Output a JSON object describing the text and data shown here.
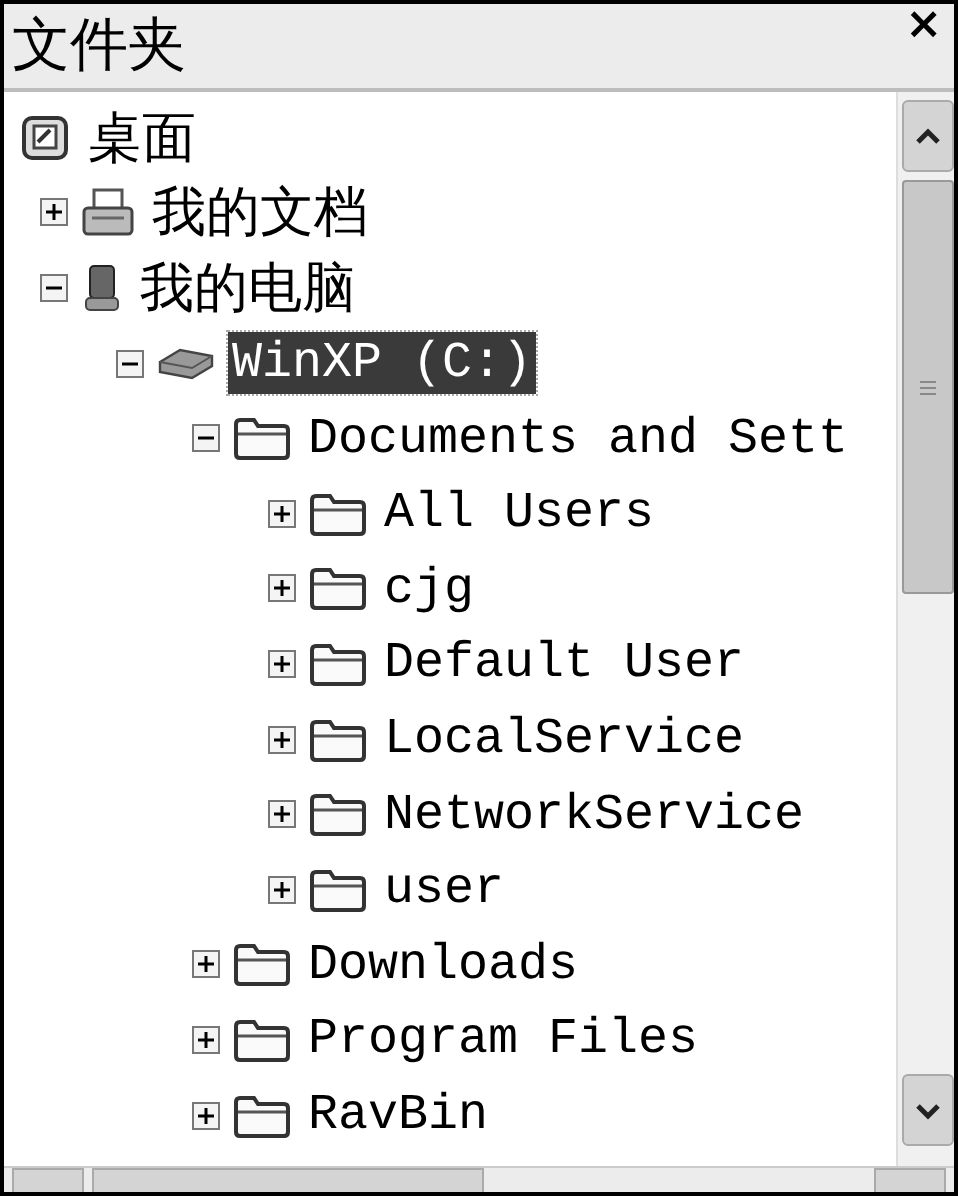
{
  "panel": {
    "title": "文件夹",
    "close": "×"
  },
  "tree": [
    {
      "label": "桌面",
      "kind": "desktop",
      "selected": false,
      "children": [
        {
          "label": "我的文档",
          "kind": "documents",
          "expanded": false,
          "selected": false
        },
        {
          "label": "我的电脑",
          "kind": "computer",
          "expanded": true,
          "selected": false,
          "children": [
            {
              "label": "WinXP (C:)",
              "kind": "drive",
              "expanded": true,
              "selected": true,
              "children": [
                {
                  "label": "Documents and Sett",
                  "kind": "folder",
                  "expanded": true,
                  "selected": false,
                  "children": [
                    {
                      "label": "All Users",
                      "kind": "folder",
                      "expanded": false,
                      "selected": false
                    },
                    {
                      "label": "cjg",
                      "kind": "folder",
                      "expanded": false,
                      "selected": false
                    },
                    {
                      "label": "Default User",
                      "kind": "folder",
                      "expanded": false,
                      "selected": false
                    },
                    {
                      "label": "LocalService",
                      "kind": "folder",
                      "expanded": false,
                      "selected": false
                    },
                    {
                      "label": "NetworkService",
                      "kind": "folder",
                      "expanded": false,
                      "selected": false
                    },
                    {
                      "label": "user",
                      "kind": "folder",
                      "expanded": false,
                      "selected": false
                    }
                  ]
                },
                {
                  "label": "Downloads",
                  "kind": "folder",
                  "expanded": false,
                  "selected": false
                },
                {
                  "label": "Program Files",
                  "kind": "folder",
                  "expanded": false,
                  "selected": false
                },
                {
                  "label": "RavBin",
                  "kind": "folder",
                  "expanded": false,
                  "selected": false
                }
              ]
            }
          ]
        }
      ]
    }
  ]
}
